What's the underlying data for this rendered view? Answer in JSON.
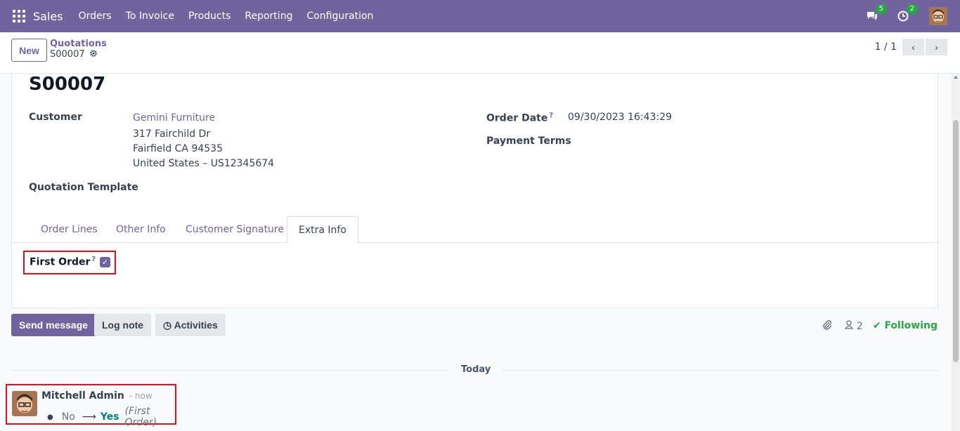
{
  "navbar": {
    "app_name": "Sales",
    "menu": [
      "Orders",
      "To Invoice",
      "Products",
      "Reporting",
      "Configuration"
    ],
    "messages_count": "5",
    "activities_count": "2"
  },
  "control_panel": {
    "new_label": "New",
    "breadcrumb_parent": "Quotations",
    "breadcrumb_current": "S00007",
    "pager": "1 / 1"
  },
  "form": {
    "title": "S00007",
    "customer_label": "Customer",
    "customer_name": "Gemini Furniture",
    "address_line1": "317 Fairchild Dr",
    "address_line2": "Fairfield CA 94535",
    "address_line3": "United States – US12345674",
    "quotation_template_label": "Quotation Template",
    "order_date_label": "Order Date",
    "order_date_value": "09/30/2023 16:43:29",
    "payment_terms_label": "Payment Terms",
    "help_mark": "?",
    "tabs": [
      "Order Lines",
      "Other Info",
      "Customer Signature",
      "Extra Info"
    ],
    "active_tab": "Extra Info",
    "first_order_label": "First Order",
    "first_order_checked": true
  },
  "chatter": {
    "send_message_label": "Send message",
    "log_note_label": "Log note",
    "activities_label": "Activities",
    "followers_count": "2",
    "following_label": "Following",
    "today_label": "Today",
    "message": {
      "author": "Mitchell Admin",
      "time": "- now",
      "old_value": "No",
      "new_value": "Yes",
      "field": "(First Order)"
    }
  },
  "colors": {
    "brand": "#71639e",
    "following": "#28a745",
    "highlight_box": "#e0101d",
    "new_value": "#017e84"
  }
}
